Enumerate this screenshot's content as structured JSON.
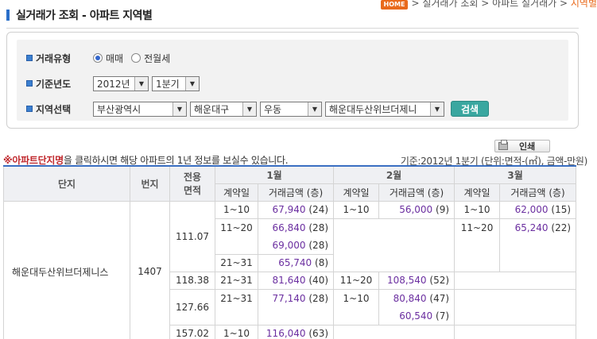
{
  "header": {
    "title": "실거래가 조회 - 아파트 지역별",
    "home_badge": "HOME",
    "breadcrumb_prefix": "> 실거래가 조회 > 아파트 실거래가 >",
    "breadcrumb_current": "지역별"
  },
  "search": {
    "type_label": "거래유형",
    "type_options": [
      "매매",
      "전월세"
    ],
    "type_selected": "매매",
    "year_label": "기준년도",
    "year_value": "2012년",
    "quarter_value": "1분기",
    "region_label": "지역선택",
    "sido": "부산광역시",
    "sigungu": "해운대구",
    "dong": "우동",
    "apt": "해운대두산위브더제니",
    "search_button": "검색"
  },
  "print_button": "인쇄",
  "notice": {
    "prefix": "※",
    "highlight": "아파트단지명",
    "suffix": "을 클릭하시면 해당 아파트의 1년 정보를 보실수 있습니다."
  },
  "unit_info": "기준:2012년 1분기  (단위:면적-(㎡), 금액-만원)",
  "table": {
    "headers": {
      "complex": "단지",
      "lot": "번지",
      "area": "전용\n면적",
      "months": [
        "1월",
        "2월",
        "3월"
      ],
      "contract_day": "계약일",
      "amount": "거래금액 (층)"
    },
    "complex_name": "해운대두산위브더제니스",
    "lot_number": "1407",
    "areas": [
      "111.07",
      "118.38",
      "127.66",
      "157.02"
    ],
    "rows": {
      "r111": {
        "m1": [
          {
            "day": "1~10",
            "amounts": [
              {
                "price": "67,940",
                "floor": "(24)"
              }
            ]
          },
          {
            "day": "11~20",
            "amounts": [
              {
                "price": "66,840",
                "floor": "(28)"
              },
              {
                "price": "69,000",
                "floor": "(28)"
              }
            ]
          },
          {
            "day": "21~31",
            "amounts": [
              {
                "price": "65,740",
                "floor": "(8)"
              }
            ]
          }
        ],
        "m2": [
          {
            "day": "1~10",
            "amounts": [
              {
                "price": "56,000",
                "floor": "(9)"
              }
            ]
          }
        ],
        "m3": [
          {
            "day": "1~10",
            "amounts": [
              {
                "price": "62,000",
                "floor": "(15)"
              }
            ]
          },
          {
            "day": "11~20",
            "amounts": [
              {
                "price": "65,240",
                "floor": "(22)"
              }
            ]
          }
        ]
      },
      "r118": {
        "m1": {
          "day": "21~31",
          "price": "81,640",
          "floor": "(40)"
        },
        "m2": {
          "day": "11~20",
          "price": "108,540",
          "floor": "(52)"
        }
      },
      "r127": {
        "m1": {
          "day": "21~31",
          "price": "77,140",
          "floor": "(28)"
        },
        "m2": {
          "day": "1~10",
          "amounts": [
            {
              "price": "80,840",
              "floor": "(47)"
            },
            {
              "price": "60,540",
              "floor": "(7)"
            }
          ]
        }
      },
      "r157": {
        "m1": {
          "day": "1~10",
          "price": "116,040",
          "floor": "(63)"
        }
      }
    }
  }
}
